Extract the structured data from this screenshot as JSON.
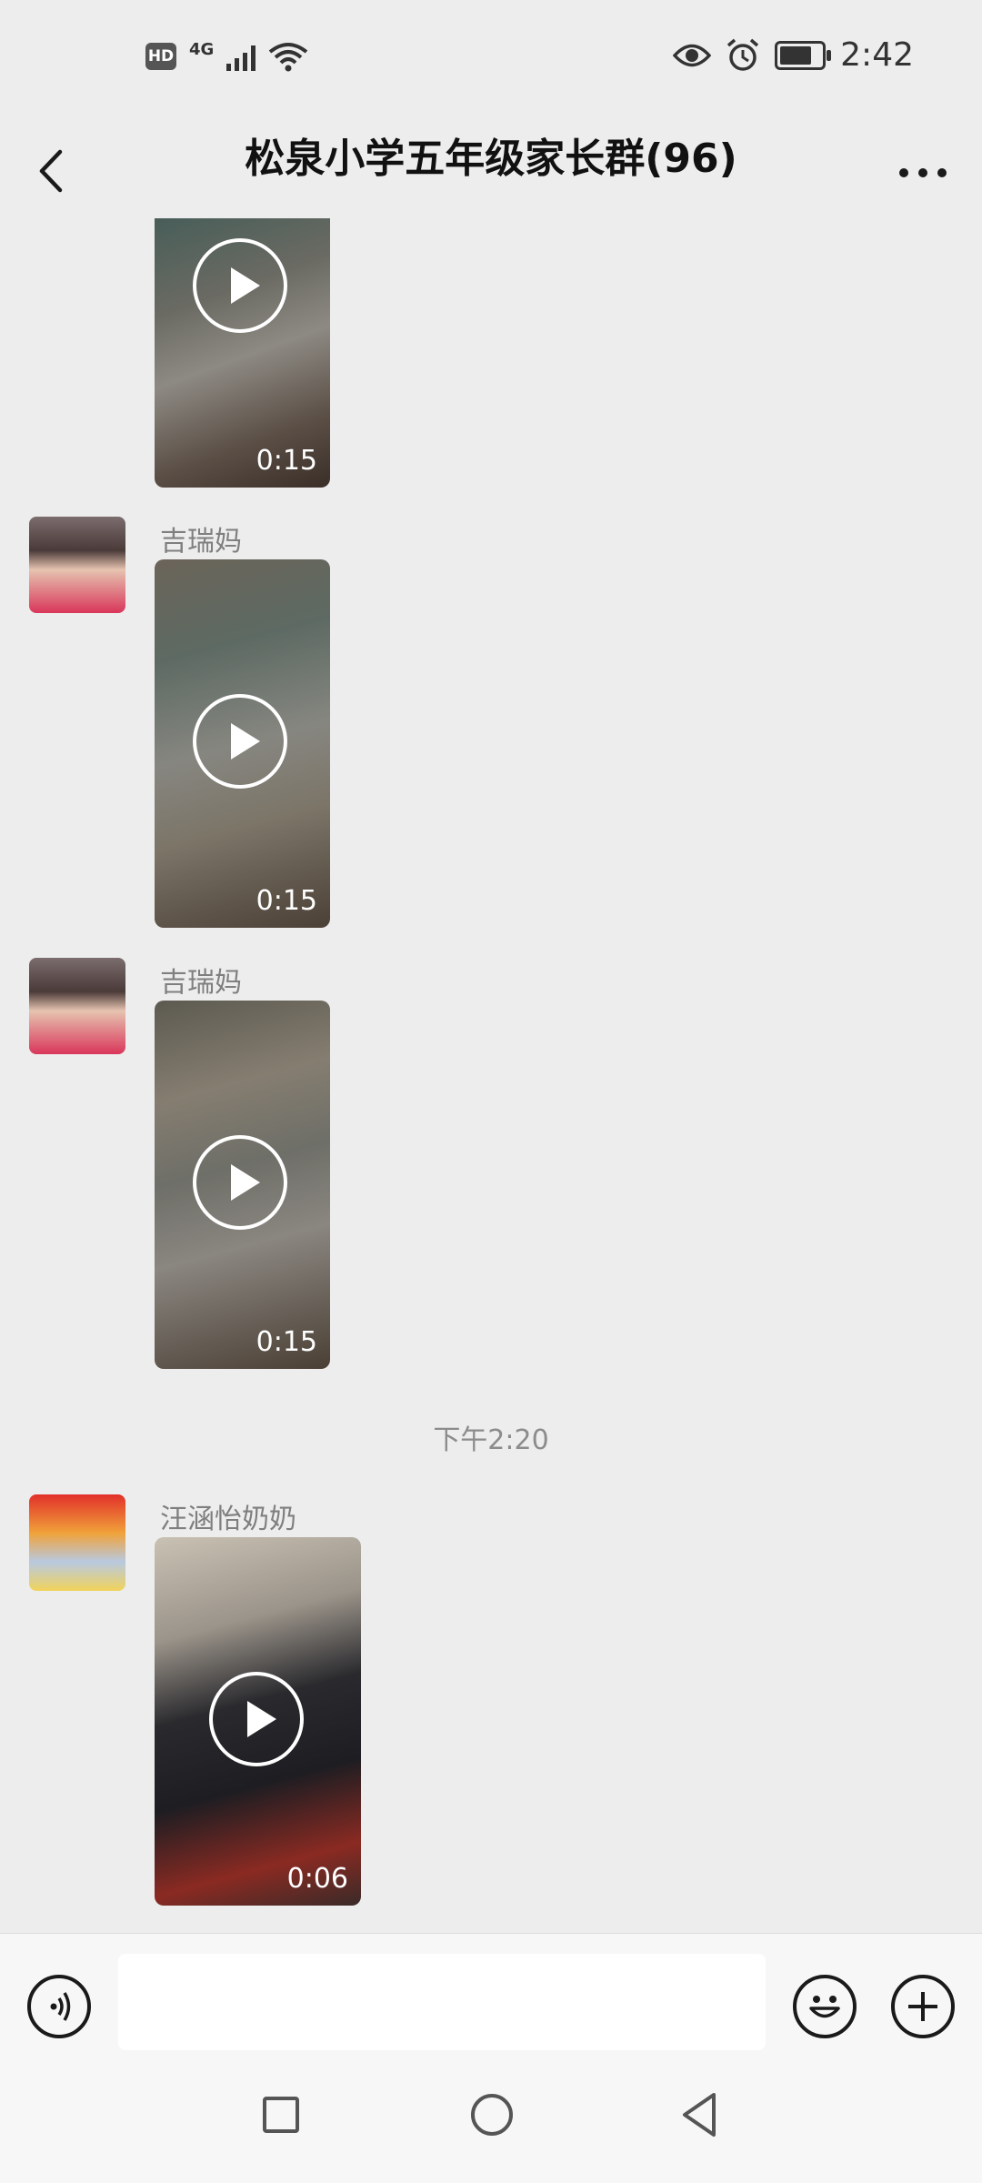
{
  "status_bar": {
    "hd_label": "HD",
    "network_label": "4G",
    "time": "2:42"
  },
  "header": {
    "title": "松泉小学五年级家长群(96)"
  },
  "messages": [
    {
      "sender": "",
      "duration": "0:15",
      "partial": true
    },
    {
      "sender": "吉瑞妈",
      "duration": "0:15"
    },
    {
      "sender": "吉瑞妈",
      "duration": "0:15"
    },
    {
      "sender": "汪涵怡奶奶",
      "duration": "0:06"
    }
  ],
  "timestamp": "下午2:20",
  "input": {
    "value": "",
    "placeholder": ""
  },
  "icons": {
    "back": "chevron-left-icon",
    "more": "more-dots-icon",
    "voice": "voice-icon",
    "emoji": "emoji-icon",
    "plus": "plus-icon"
  },
  "colors": {
    "background": "#ededed",
    "bar": "#f7f7f7"
  }
}
